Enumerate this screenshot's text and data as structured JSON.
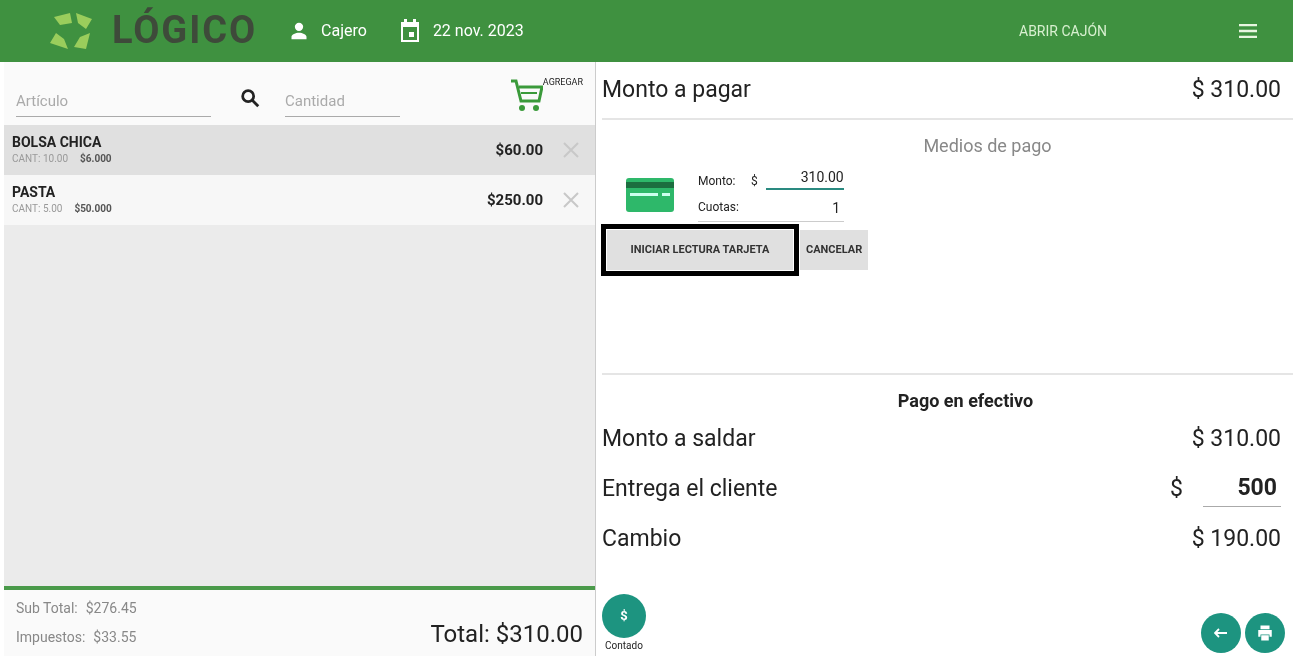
{
  "header": {
    "logo": "LÓGICO",
    "user": "Cajero",
    "date": "22 nov. 2023",
    "drawer_button": "ABRIR CAJÓN"
  },
  "search": {
    "article_placeholder": "Artículo",
    "quantity_placeholder": "Cantidad",
    "add_label": "AGREGAR"
  },
  "items": [
    {
      "name": "BOLSA CHICA",
      "qty": "CANT: 10.00",
      "unit_price": "$6.000",
      "amount": "$60.00",
      "selected": true
    },
    {
      "name": "PASTA",
      "qty": "CANT: 5.00",
      "unit_price": "$50.000",
      "amount": "$250.00",
      "selected": false
    }
  ],
  "totals": {
    "subtotal_label": "Sub Total:",
    "subtotal": "$276.45",
    "tax_label": "Impuestos:",
    "tax": "$33.55",
    "total": "Total: $310.00"
  },
  "payment": {
    "label": "Monto a pagar",
    "amount": "$ 310.00",
    "methods_title": "Medios de pago",
    "card": {
      "amount_label": "Monto:",
      "currency": "$",
      "amount": "310.00",
      "installments_label": "Cuotas:",
      "installments": "1"
    },
    "buttons": [
      {
        "label": "INICIAR LECTURA TARJETA",
        "highlighted": true
      },
      {
        "label": "CANCELAR",
        "highlighted": false
      }
    ]
  },
  "cash": {
    "title": "Pago en efectivo",
    "rows": [
      {
        "kind": "text",
        "label": "Monto a saldar",
        "value": "$ 310.00"
      },
      {
        "kind": "input",
        "label": "Entrega el cliente",
        "currency": "$",
        "value": "500"
      },
      {
        "kind": "text",
        "label": "Cambio",
        "value": "$ 190.00"
      }
    ]
  },
  "footer": {
    "cash_button": "$",
    "cash_label": "Contado"
  }
}
